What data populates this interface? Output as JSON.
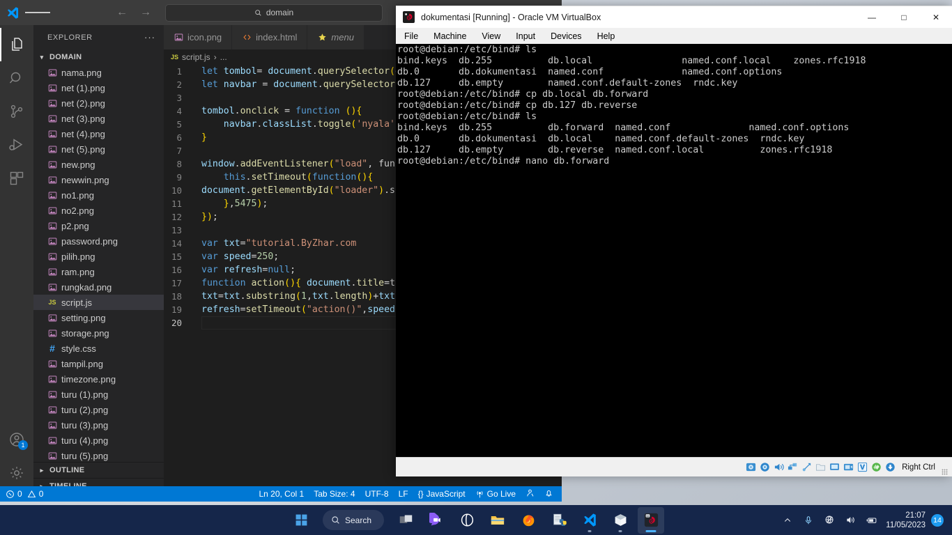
{
  "vscode": {
    "titlebar": {
      "logo_icon": "vscode-logo-icon",
      "menu_icon": "hamburger-menu-icon",
      "back_icon": "arrow-left-icon",
      "forward_icon": "arrow-right-icon",
      "search_icon": "search-icon",
      "search_value": "domain"
    },
    "activitybar": [
      {
        "name": "explorer",
        "icon": "files-icon",
        "active": true
      },
      {
        "name": "search",
        "icon": "search-icon",
        "active": false
      },
      {
        "name": "source-control",
        "icon": "source-control-icon",
        "active": false
      },
      {
        "name": "run-debug",
        "icon": "run-and-debug-icon",
        "active": false
      },
      {
        "name": "extensions",
        "icon": "extensions-icon",
        "active": false
      }
    ],
    "activitybar_bottom": [
      {
        "name": "accounts",
        "icon": "account-icon",
        "badge": "1"
      },
      {
        "name": "manage",
        "icon": "gear-icon",
        "badge": ""
      }
    ],
    "sidebar": {
      "header": "EXPLORER",
      "more_actions": "···",
      "folder": "DOMAIN",
      "files": [
        {
          "label": "nama.png",
          "type": "image"
        },
        {
          "label": "net (1).png",
          "type": "image"
        },
        {
          "label": "net (2).png",
          "type": "image"
        },
        {
          "label": "net (3).png",
          "type": "image"
        },
        {
          "label": "net (4).png",
          "type": "image"
        },
        {
          "label": "net (5).png",
          "type": "image"
        },
        {
          "label": "new.png",
          "type": "image"
        },
        {
          "label": "newwin.png",
          "type": "image"
        },
        {
          "label": "no1.png",
          "type": "image"
        },
        {
          "label": "no2.png",
          "type": "image"
        },
        {
          "label": "p2.png",
          "type": "image"
        },
        {
          "label": "password.png",
          "type": "image"
        },
        {
          "label": "pilih.png",
          "type": "image"
        },
        {
          "label": "ram.png",
          "type": "image"
        },
        {
          "label": "rungkad.png",
          "type": "image"
        },
        {
          "label": "script.js",
          "type": "js",
          "selected": true
        },
        {
          "label": "setting.png",
          "type": "image"
        },
        {
          "label": "storage.png",
          "type": "image"
        },
        {
          "label": "style.css",
          "type": "css"
        },
        {
          "label": "tampil.png",
          "type": "image"
        },
        {
          "label": "timezone.png",
          "type": "image"
        },
        {
          "label": "turu (1).png",
          "type": "image"
        },
        {
          "label": "turu (2).png",
          "type": "image"
        },
        {
          "label": "turu (3).png",
          "type": "image"
        },
        {
          "label": "turu (4).png",
          "type": "image"
        },
        {
          "label": "turu (5).png",
          "type": "image"
        }
      ],
      "outline": "OUTLINE",
      "timeline": "TIMELINE"
    },
    "tabs": [
      {
        "label": "icon.png",
        "icon": "image-file-icon",
        "italic": false
      },
      {
        "label": "index.html",
        "icon": "html-file-icon",
        "italic": false
      },
      {
        "label": "menu",
        "icon": "star-file-icon",
        "italic": true
      }
    ],
    "breadcrumb": {
      "file": "script.js",
      "separator": "›",
      "rest": "..."
    },
    "code_lines": [
      {
        "n": "1",
        "text": "let tombol= document.querySelector(d"
      },
      {
        "n": "2",
        "text": "let navbar = document.querySelector"
      },
      {
        "n": "3",
        "text": ""
      },
      {
        "n": "4",
        "text": "tombol.onclick = function (){"
      },
      {
        "n": "5",
        "text": "    navbar.classList.toggle('nyala'"
      },
      {
        "n": "6",
        "text": "}"
      },
      {
        "n": "7",
        "text": ""
      },
      {
        "n": "8",
        "text": "window.addEventListener(\"load\", fun"
      },
      {
        "n": "9",
        "text": "    this.setTimeout(function(){"
      },
      {
        "n": "10",
        "text": "document.getElementById(\"loader\").s"
      },
      {
        "n": "11",
        "text": "    },5475);"
      },
      {
        "n": "12",
        "text": "});"
      },
      {
        "n": "13",
        "text": ""
      },
      {
        "n": "14",
        "text": "var txt=\"tutorial.ByZhar.com"
      },
      {
        "n": "15",
        "text": "var speed=250;"
      },
      {
        "n": "16",
        "text": "var refresh=null;"
      },
      {
        "n": "17",
        "text": "function action(){ document.title=t"
      },
      {
        "n": "18",
        "text": "txt=txt.substring(1,txt.length)+txt"
      },
      {
        "n": "19",
        "text": "refresh=setTimeout(\"action()\",speed"
      },
      {
        "n": "20",
        "text": ""
      }
    ],
    "statusbar": {
      "errors": "0",
      "warnings": "0",
      "position": "Ln 20, Col 1",
      "tab_size": "Tab Size: 4",
      "encoding": "UTF-8",
      "eol": "LF",
      "language": "JavaScript",
      "language_prefix": "{}",
      "go_live": "Go Live",
      "remote_icon": "remote-window-icon",
      "bell_icon": "notifications-bell-icon",
      "error_icon": "error-circle-icon",
      "warning_icon": "warning-triangle-icon",
      "broadcast_icon": "broadcast-icon"
    }
  },
  "virtualbox": {
    "title": "dokumentasi [Running] - Oracle VM VirtualBox",
    "app_icon": "virtualbox-vm-icon",
    "window_controls": {
      "minimize": "—",
      "maximize": "□",
      "close": "✕"
    },
    "menu": [
      "File",
      "Machine",
      "View",
      "Input",
      "Devices",
      "Help"
    ],
    "terminal_lines": [
      "root@debian:/etc/bind# ls",
      "bind.keys  db.255          db.local                named.conf.local    zones.rfc1918",
      "db.0       db.dokumentasi  named.conf              named.conf.options",
      "db.127     db.empty        named.conf.default-zones  rndc.key",
      "root@debian:/etc/bind# cp db.local db.forward",
      "root@debian:/etc/bind# cp db.127 db.reverse",
      "root@debian:/etc/bind# ls",
      "bind.keys  db.255          db.forward  named.conf              named.conf.options",
      "db.0       db.dokumentasi  db.local    named.conf.default-zones  rndc.key",
      "db.127     db.empty        db.reverse  named.conf.local          zones.rfc1918",
      "root@debian:/etc/bind# nano db.forward"
    ],
    "status_icons": [
      "hard-disk-icon",
      "optical-disk-icon",
      "audio-icon",
      "network-icon",
      "usb-icon",
      "shared-folder-icon",
      "display-icon",
      "recording-icon",
      "virtualization-icon",
      "mouse-integration-icon",
      "keyboard-icon"
    ],
    "host_key": "Right Ctrl"
  },
  "taskbar": {
    "start_icon": "windows-start-icon",
    "search_icon": "search-icon",
    "search_label": "Search",
    "apps": [
      {
        "name": "task-view",
        "icon": "task-view-icon"
      },
      {
        "name": "teams-chat",
        "icon": "chat-icon"
      },
      {
        "name": "browser-app",
        "icon": "browser-icon"
      },
      {
        "name": "file-explorer",
        "icon": "folder-icon"
      },
      {
        "name": "firefox",
        "icon": "firefox-icon"
      },
      {
        "name": "python-idle",
        "icon": "python-icon"
      },
      {
        "name": "vscode",
        "icon": "vscode-icon",
        "running": true
      },
      {
        "name": "virtualbox-manager",
        "icon": "virtualbox-icon",
        "running": true
      },
      {
        "name": "virtualbox-vm",
        "icon": "virtualbox-vm-icon",
        "running": true,
        "active": true
      }
    ],
    "tray": {
      "chevron": "show-hidden-icons",
      "mic_icon": "microphone-icon",
      "network_icon": "network-globe-icon",
      "volume_icon": "speaker-icon",
      "battery_icon": "battery-charging-icon",
      "time": "21:07",
      "date": "11/05/2023",
      "notification_count": "14"
    }
  }
}
